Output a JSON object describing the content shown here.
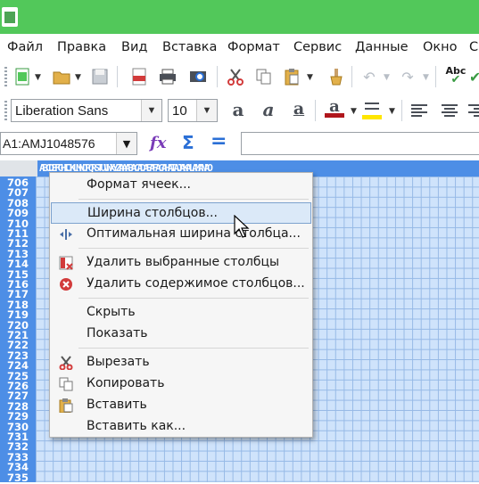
{
  "menubar": {
    "items": [
      {
        "label": "Файл"
      },
      {
        "label": "Правка"
      },
      {
        "label": "Вид"
      },
      {
        "label": "Вставка"
      },
      {
        "label": "Формат"
      },
      {
        "label": "Сервис"
      },
      {
        "label": "Данные"
      },
      {
        "label": "Окно"
      },
      {
        "label": "С"
      }
    ]
  },
  "toolbar2": {
    "font_name": "Liberation Sans",
    "font_size": "10"
  },
  "formula": {
    "name_box": "A1:AMJ1048576",
    "content": ""
  },
  "sheet": {
    "column_header_text": "ABCDEFGHIJKLMNOPQRSTUVWXYZAAABACADAEAFAGAHAIAJAKALAMANAO",
    "rows": [
      "706",
      "707",
      "708",
      "709",
      "710",
      "711",
      "712",
      "713",
      "714",
      "715",
      "716",
      "717",
      "718",
      "719",
      "720",
      "721",
      "722",
      "723",
      "724",
      "725",
      "726",
      "727",
      "728",
      "729",
      "730",
      "731",
      "732",
      "733",
      "734",
      "735"
    ]
  },
  "context_menu": {
    "items": [
      {
        "label": "Формат ячеек...",
        "icon": "none"
      },
      {
        "label": "Ширина столбцов...",
        "icon": "none",
        "highlighted": true
      },
      {
        "label": "Оптимальная ширина столбца...",
        "icon": "optimal-width-icon"
      },
      {
        "label": "Удалить выбранные столбцы",
        "icon": "delete-columns-icon"
      },
      {
        "label": "Удалить содержимое столбцов...",
        "icon": "clear-contents-icon"
      },
      {
        "label": "Скрыть",
        "icon": "none"
      },
      {
        "label": "Показать",
        "icon": "none"
      },
      {
        "label": "Вырезать",
        "icon": "scissors-icon"
      },
      {
        "label": "Копировать",
        "icon": "copy-icon"
      },
      {
        "label": "Вставить",
        "icon": "paste-icon"
      },
      {
        "label": "Вставить как...",
        "icon": "none"
      }
    ]
  },
  "colors": {
    "titlebar": "#52c85a",
    "header_selected": "#4d8ee6",
    "cell_selected": "#cfe3fb",
    "menu_highlight": "#dbe9f8"
  }
}
